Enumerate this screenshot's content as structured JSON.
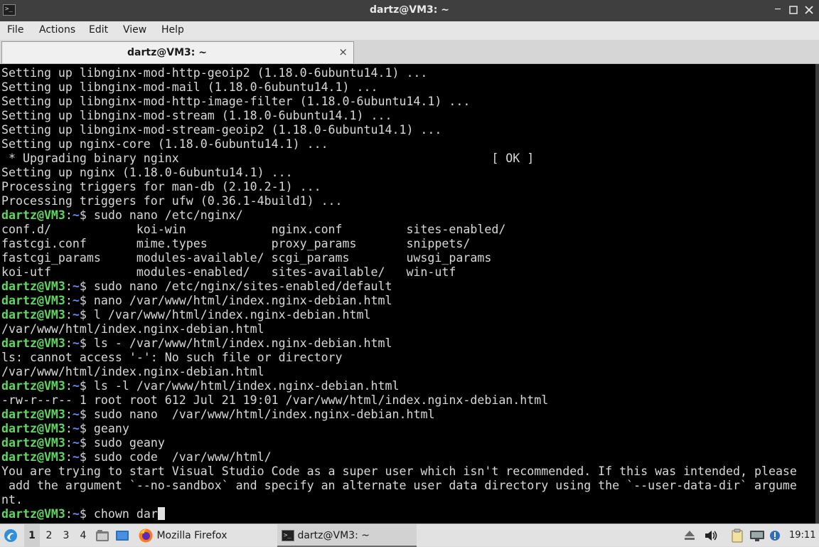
{
  "window": {
    "title": "dartz@VM3: ~",
    "app_icon": "terminal-icon",
    "controls": [
      "minimize",
      "maximize",
      "close"
    ]
  },
  "menu": [
    "File",
    "Actions",
    "Edit",
    "View",
    "Help"
  ],
  "tab": {
    "label": "dartz@VM3: ~",
    "close_glyph": "×"
  },
  "terminal": {
    "prompt_user": "dartz@VM3",
    "prompt_path": "~",
    "lines": [
      {
        "text": "Setting up libnginx-mod-http-geoip2 (1.18.0-6ubuntu14.1) ..."
      },
      {
        "text": "Setting up libnginx-mod-mail (1.18.0-6ubuntu14.1) ..."
      },
      {
        "text": "Setting up libnginx-mod-http-image-filter (1.18.0-6ubuntu14.1) ..."
      },
      {
        "text": "Setting up libnginx-mod-stream (1.18.0-6ubuntu14.1) ..."
      },
      {
        "text": "Setting up libnginx-mod-stream-geoip2 (1.18.0-6ubuntu14.1) ..."
      },
      {
        "text": "Setting up nginx-core (1.18.0-6ubuntu14.1) ..."
      },
      {
        "text": " * Upgrading binary nginx                                            [ OK ]"
      },
      {
        "text": "Setting up nginx (1.18.0-6ubuntu14.1) ..."
      },
      {
        "text": "Processing triggers for man-db (2.10.2-1) ..."
      },
      {
        "text": "Processing triggers for ufw (0.36.1-4build1) ..."
      },
      {
        "prompt": true,
        "text": "$ sudo nano /etc/nginx/"
      },
      {
        "text": "conf.d/            koi-win            nginx.conf         sites-enabled/"
      },
      {
        "text": "fastcgi.conf       mime.types         proxy_params       snippets/"
      },
      {
        "text": "fastcgi_params     modules-available/ scgi_params        uwsgi_params"
      },
      {
        "text": "koi-utf            modules-enabled/   sites-available/   win-utf"
      },
      {
        "prompt": true,
        "text": "$ sudo nano /etc/nginx/sites-enabled/default"
      },
      {
        "prompt": true,
        "text": "$ nano /var/www/html/index.nginx-debian.html"
      },
      {
        "prompt": true,
        "text": "$ l /var/www/html/index.nginx-debian.html"
      },
      {
        "text": "/var/www/html/index.nginx-debian.html"
      },
      {
        "prompt": true,
        "text": "$ ls - /var/www/html/index.nginx-debian.html"
      },
      {
        "text": "ls: cannot access '-': No such file or directory"
      },
      {
        "text": "/var/www/html/index.nginx-debian.html"
      },
      {
        "prompt": true,
        "text": "$ ls -l /var/www/html/index.nginx-debian.html"
      },
      {
        "text": "-rw-r--r-- 1 root root 612 Jul 21 19:01 /var/www/html/index.nginx-debian.html"
      },
      {
        "prompt": true,
        "text": "$ sudo nano  /var/www/html/index.nginx-debian.html"
      },
      {
        "prompt": true,
        "text": "$ geany"
      },
      {
        "prompt": true,
        "text": "$ sudo geany"
      },
      {
        "prompt": true,
        "text": "$ sudo code  /var/www/html/"
      },
      {
        "text": "You are trying to start Visual Studio Code as a super user which isn't recommended. If this was intended, please"
      },
      {
        "text": " add the argument `--no-sandbox` and specify an alternate user data directory using the `--user-data-dir` argume"
      },
      {
        "text": "nt."
      },
      {
        "prompt": true,
        "cursor": true,
        "text": "$ chown dar"
      }
    ]
  },
  "taskbar": {
    "start_icon": "lxqt-start-icon",
    "workspaces": [
      "1",
      "2",
      "3",
      "4"
    ],
    "active_workspace": "1",
    "quicklaunch": [
      "file-manager-icon",
      "show-desktop-icon"
    ],
    "tasks": [
      {
        "label": "Mozilla Firefox",
        "icon": "firefox-icon",
        "active": false
      },
      {
        "label": "dartz@VM3: ~",
        "icon": "terminal-icon",
        "active": true
      }
    ],
    "tray": [
      "eject-icon",
      "volume-icon",
      "clipboard-icon",
      "network-icon",
      "notification-icon"
    ],
    "clock": "19:11"
  },
  "colors": {
    "terminal_bg": "#000000",
    "terminal_fg": "#d8d8d8",
    "prompt_user": "#5fd75f",
    "prompt_path": "#5f87ff",
    "titlebar_bg": "#3f3f3f"
  }
}
